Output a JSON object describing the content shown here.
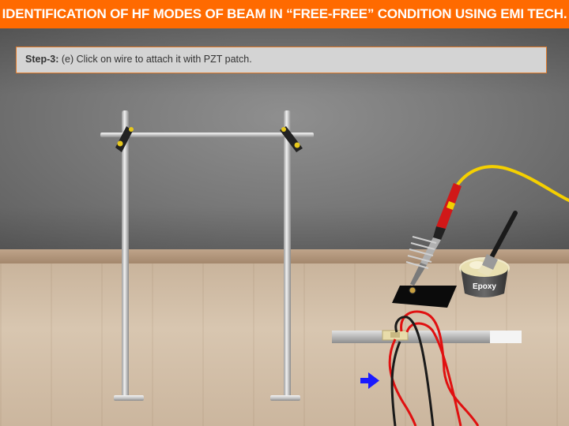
{
  "header": {
    "title": "IDENTIFICATION OF HF MODES OF BEAM IN “FREE-FREE” CONDITION USING EMI TECH."
  },
  "instruction": {
    "step_label": "Step-3:",
    "text": " (e) Click on wire to attach it with PZT patch."
  },
  "epoxy": {
    "label": "Epoxy"
  },
  "colors": {
    "header_bg": "#ff6a00",
    "instruction_border": "#e07a2a",
    "arrow": "#1a1aff",
    "wire_red": "#e01010",
    "wire_black": "#1a1a1a",
    "soldering_cable": "#f5d000"
  },
  "icons": {
    "pointer": "right-arrow-icon"
  }
}
